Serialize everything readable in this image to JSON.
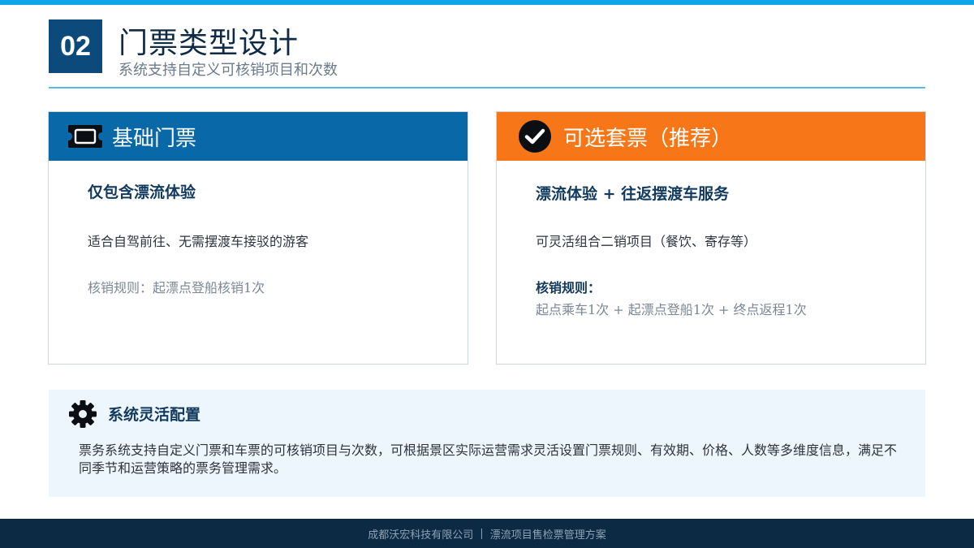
{
  "header": {
    "section_number": "02",
    "title": "门票类型设计",
    "subtitle": "系统支持自定义可核销项目和次数"
  },
  "cards": {
    "basic": {
      "title": "基础门票",
      "icon": "ticket-icon",
      "heading": "仅包含漂流体验",
      "description": "适合自驾前往、无需摆渡车接驳的游客",
      "rule": "核销规则：起漂点登船核销1次"
    },
    "package": {
      "title": "可选套票（推荐）",
      "icon": "check-circle-icon",
      "heading": "漂流体验 + 往返摆渡车服务",
      "description": "可灵活组合二销项目（餐饮、寄存等）",
      "rule_label": "核销规则：",
      "rule": "起点乘车1次 + 起漂点登船1次 + 终点返程1次"
    }
  },
  "config": {
    "icon": "gear-icon",
    "title": "系统灵活配置",
    "text": "票务系统支持自定义门票和车票的可核销项目与次数，可根据景区实际运营需求灵活设置门票规则、有效期、价格、人数等多维度信息，满足不同季节和运营策略的票务管理需求。"
  },
  "footer": {
    "company": "成都沃宏科技有限公司",
    "separator": "|",
    "project": "漂流项目售检票管理方案"
  },
  "colors": {
    "accent_blue": "#0868a8",
    "accent_orange": "#f77718",
    "navy": "#0c2a44",
    "sky": "#0ea5e9"
  }
}
